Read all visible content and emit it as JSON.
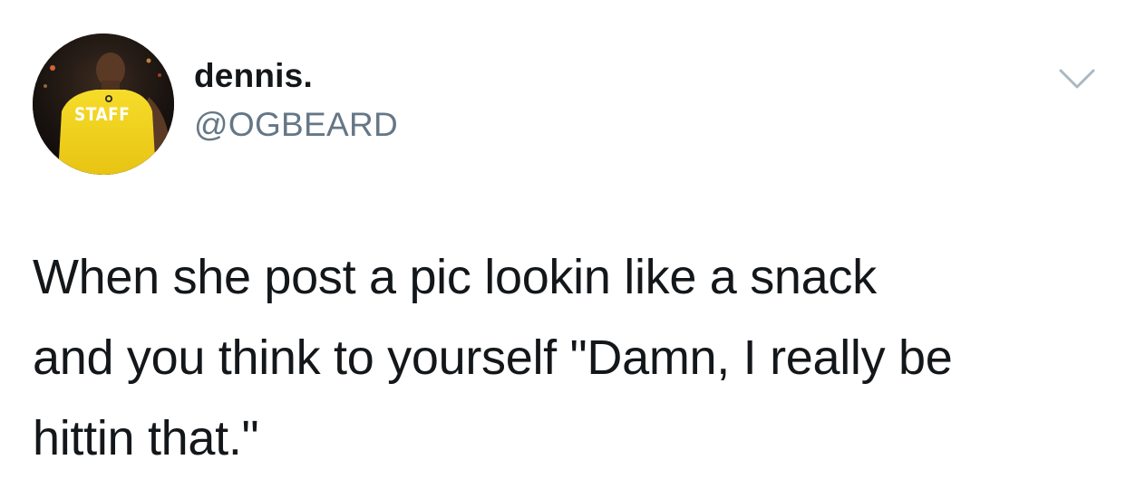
{
  "user": {
    "display_name": "dennis.",
    "handle": "@OGBEARD",
    "avatar_badge_text": "STAFF"
  },
  "tweet": {
    "lines": [
      "When she post a pic lookin like a snack",
      "and you think to yourself \"Damn, I really be",
      "hittin that.\""
    ]
  },
  "icons": {
    "menu": "chevron-down-icon"
  },
  "colors": {
    "name": "#14171a",
    "handle": "#657786",
    "caret": "#aab8c2",
    "shirt": "#f2d21b"
  }
}
